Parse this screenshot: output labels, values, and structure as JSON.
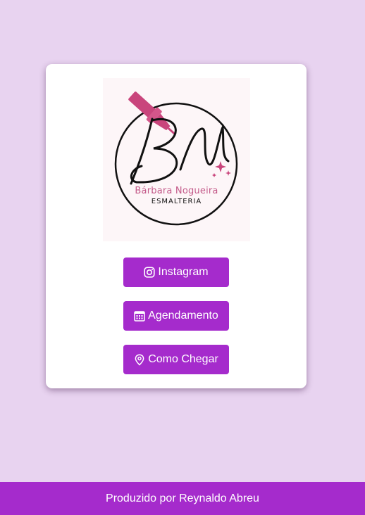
{
  "logo": {
    "monogram": "BN",
    "name": "Bárbara Nogueira",
    "subtitle": "ESMALTERIA"
  },
  "buttons": [
    {
      "label": "Instagram",
      "icon": "instagram-icon"
    },
    {
      "label": "Agendamento",
      "icon": "calendar-icon"
    },
    {
      "label": "Como Chegar",
      "icon": "map-pin-icon"
    }
  ],
  "footer": {
    "text": "Produzido por Reynaldo Abreu"
  },
  "colors": {
    "background": "#e8d3f0",
    "accent": "#a52bcc",
    "logo_pink": "#c45b8a"
  }
}
